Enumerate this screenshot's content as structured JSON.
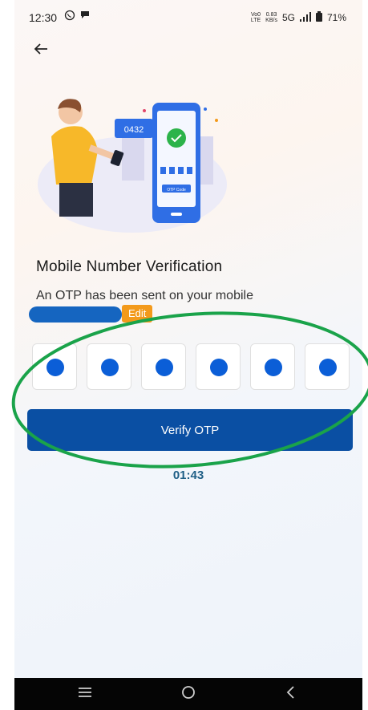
{
  "status_bar": {
    "time": "12:30",
    "network_small_top": "0.83",
    "network_small_bottom": "KB/s",
    "network_type": "5G",
    "lte_label": "Vo0\nLTE",
    "battery": "71%"
  },
  "header": {
    "back_icon": "arrow-left-icon"
  },
  "illustration": {
    "code_digits": "0432",
    "otp_badge": "OTP Code"
  },
  "verification": {
    "title": "Mobile Number Verification",
    "subtitle": "An OTP has been sent on your mobile",
    "edit_label": "Edit",
    "otp_count": 6,
    "verify_label": "Verify OTP",
    "timer": "01:43"
  },
  "colors": {
    "primary": "#0a4fa3",
    "otp_dot": "#0b5ed7",
    "edit": "#f39a1b",
    "timer": "#1f5f86",
    "highlight": "#1aa34a"
  },
  "nav_bar": {
    "recent_icon": "menu-lines-icon",
    "home_icon": "circle-home-icon",
    "back_icon": "chevron-left-icon"
  }
}
